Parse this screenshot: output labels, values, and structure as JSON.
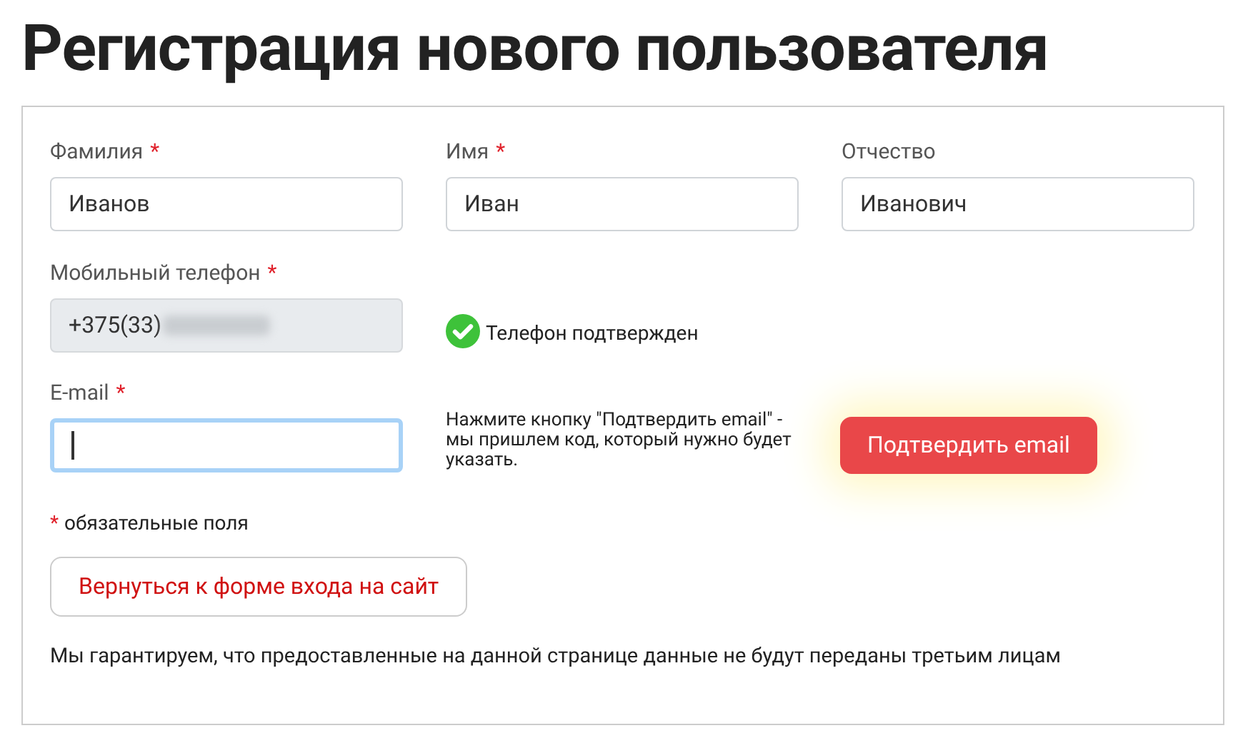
{
  "title": "Регистрация нового пользователя",
  "name_fields": [
    {
      "label": "Фамилия",
      "required": true,
      "value": "Иванов"
    },
    {
      "label": "Имя",
      "required": true,
      "value": "Иван"
    },
    {
      "label": "Отчество",
      "required": false,
      "value": "Иванович"
    }
  ],
  "phone": {
    "label": "Мобильный телефон",
    "required": true,
    "value": "+375(33)",
    "disabled": true,
    "redacted": true,
    "status": "Телефон подтвержден",
    "verified": true
  },
  "email": {
    "label": "E-mail",
    "required": true,
    "focused": true,
    "hint": "Нажмите кнопку \"Подтвердить email\" - мы пришлем код, который нужно будет указать.",
    "button": "Подтвердить email"
  },
  "required_mark": "*",
  "required_note": "обязательные поля",
  "back_button": "Вернуться к форме входа на сайт",
  "privacy_note": "Мы гарантируем, что предоставленные на данной странице данные не будут переданы третьим лицам"
}
